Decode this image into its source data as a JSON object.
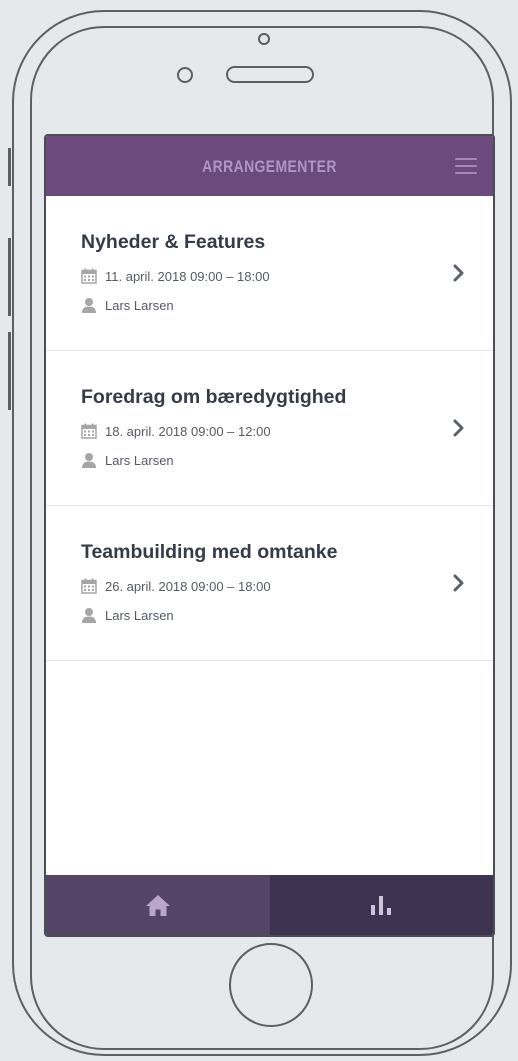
{
  "header": {
    "title": "ARRANGEMENTER",
    "menu_icon": "hamburger-menu-icon"
  },
  "events": [
    {
      "title": "Nyheder & Features",
      "date": "11. april. 2018",
      "time": "09:00 – 18:00",
      "person": "Lars Larsen"
    },
    {
      "title": "Foredrag om bæredygtighed",
      "date": "18. april. 2018",
      "time": "09:00 – 12:00",
      "person": "Lars Larsen"
    },
    {
      "title": "Teambuilding med omtanke",
      "date": "26. april. 2018",
      "time": "09:00 – 18:00",
      "person": "Lars Larsen"
    }
  ],
  "tabbar": {
    "tabs": [
      {
        "icon": "home-icon",
        "active": true
      },
      {
        "icon": "bar-chart-icon",
        "active": false
      }
    ]
  },
  "colors": {
    "header_bg": "#6c4a7e",
    "header_text": "#b395c2",
    "tab_active": "#544566",
    "tab_inactive": "#3d3350",
    "icon_grey": "#a6a6a6"
  }
}
